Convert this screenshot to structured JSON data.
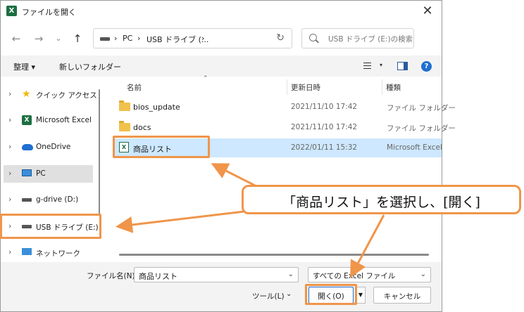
{
  "dialog": {
    "title": "ファイルを開く",
    "app_icon": "X",
    "close_glyph": "✕"
  },
  "nav": {
    "back_glyph": "←",
    "forward_glyph": "→",
    "recent_glyph": "⌄",
    "up_glyph": "↑",
    "address": [
      "›",
      "PC",
      "›",
      "USB ドライブ (...",
      "›"
    ],
    "refresh_glyph": "↻",
    "search_placeholder": "USB ドライブ (E:)の検索"
  },
  "commands": {
    "organize": "整理 ▾",
    "new_folder": "新しいフォルダー",
    "help_glyph": "?",
    "view_caret": "▾"
  },
  "sidebar": {
    "items": [
      {
        "label": "クイック アクセス",
        "icon": "star-icon"
      },
      {
        "label": "Microsoft Excel",
        "icon": "excel-icon"
      },
      {
        "label": "OneDrive",
        "icon": "cloud-icon"
      },
      {
        "label": "PC",
        "icon": "pc-icon"
      },
      {
        "label": "g-drive (D:)",
        "icon": "drive-icon"
      },
      {
        "label": "USB ドライブ (E:)",
        "icon": "drive-icon"
      },
      {
        "label": "ネットワーク",
        "icon": "network-icon"
      }
    ],
    "chevron": "›"
  },
  "files": {
    "columns": {
      "name": "名前",
      "date": "更新日時",
      "type": "種類"
    },
    "sort_caret": "⌃",
    "rows": [
      {
        "name": "bios_update",
        "date": "2021/11/10 17:42",
        "type": "ファイル フォルダー",
        "icon": "folder-icon"
      },
      {
        "name": "docs",
        "date": "2021/11/10 17:42",
        "type": "ファイル フォルダー",
        "icon": "folder-icon"
      },
      {
        "name": "商品リスト",
        "date": "2022/01/11 15:32",
        "type": "Microsoft Excel",
        "icon": "excel-file-icon"
      }
    ],
    "xls_glyph": "X"
  },
  "bottom": {
    "filename_label": "ファイル名(N):",
    "filename_value": "商品リスト",
    "filetype_value": "すべての Excel ファイル",
    "tools_label": "ツール(L)",
    "open_label": "開く(O)",
    "cancel_label": "キャンセル",
    "caret": "⌄",
    "split_caret": "▼"
  },
  "annotation": {
    "callout_text": "「商品リスト」を選択し、[開く]",
    "color": "#f0954a"
  }
}
